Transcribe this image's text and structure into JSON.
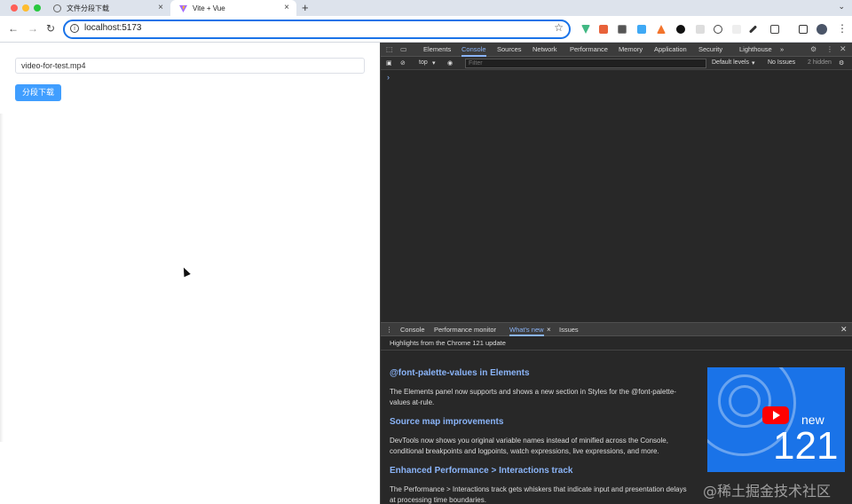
{
  "browser": {
    "tabs": [
      {
        "title": "文件分段下载",
        "active": false
      },
      {
        "title": "Vite + Vue",
        "active": true
      }
    ],
    "new_tab_label": "+",
    "tab_menu": "⌄",
    "url": "localhost:5173"
  },
  "page": {
    "file_input_value": "video-for-test.mp4",
    "download_button_label": "分段下载",
    "accent_color": "#409eff"
  },
  "devtools": {
    "tabs": [
      "Elements",
      "Console",
      "Sources",
      "Network",
      "Performance",
      "Memory",
      "Application",
      "Security",
      "Lighthouse"
    ],
    "active_tab": "Console",
    "more_tabs": "»",
    "filterbar": {
      "context": "top",
      "filter_placeholder": "Filter",
      "levels": "Default levels",
      "issues": "No Issues",
      "hidden": "2 hidden"
    },
    "prompt": "›",
    "drawer": {
      "tabs": [
        "Console",
        "Performance monitor",
        "What's new",
        "Issues"
      ],
      "active_tab": "What's new",
      "header": "Highlights from the Chrome 121 update",
      "sections": [
        {
          "title": "@font-palette-values in Elements",
          "body": "The Elements panel now supports and shows a new section in Styles for the @font-palette-values at-rule."
        },
        {
          "title": "Source map improvements",
          "body": "DevTools now shows you original variable names instead of minified across the Console, conditional breakpoints and logpoints, watch expressions, live expressions, and more."
        },
        {
          "title": "Enhanced Performance > Interactions track",
          "body": "The Performance > Interactions track gets whiskers that indicate input and presentation delays at processing time boundaries."
        }
      ],
      "promo": {
        "label": "new",
        "version": "121"
      }
    }
  },
  "watermark": "@稀土掘金技术社区"
}
